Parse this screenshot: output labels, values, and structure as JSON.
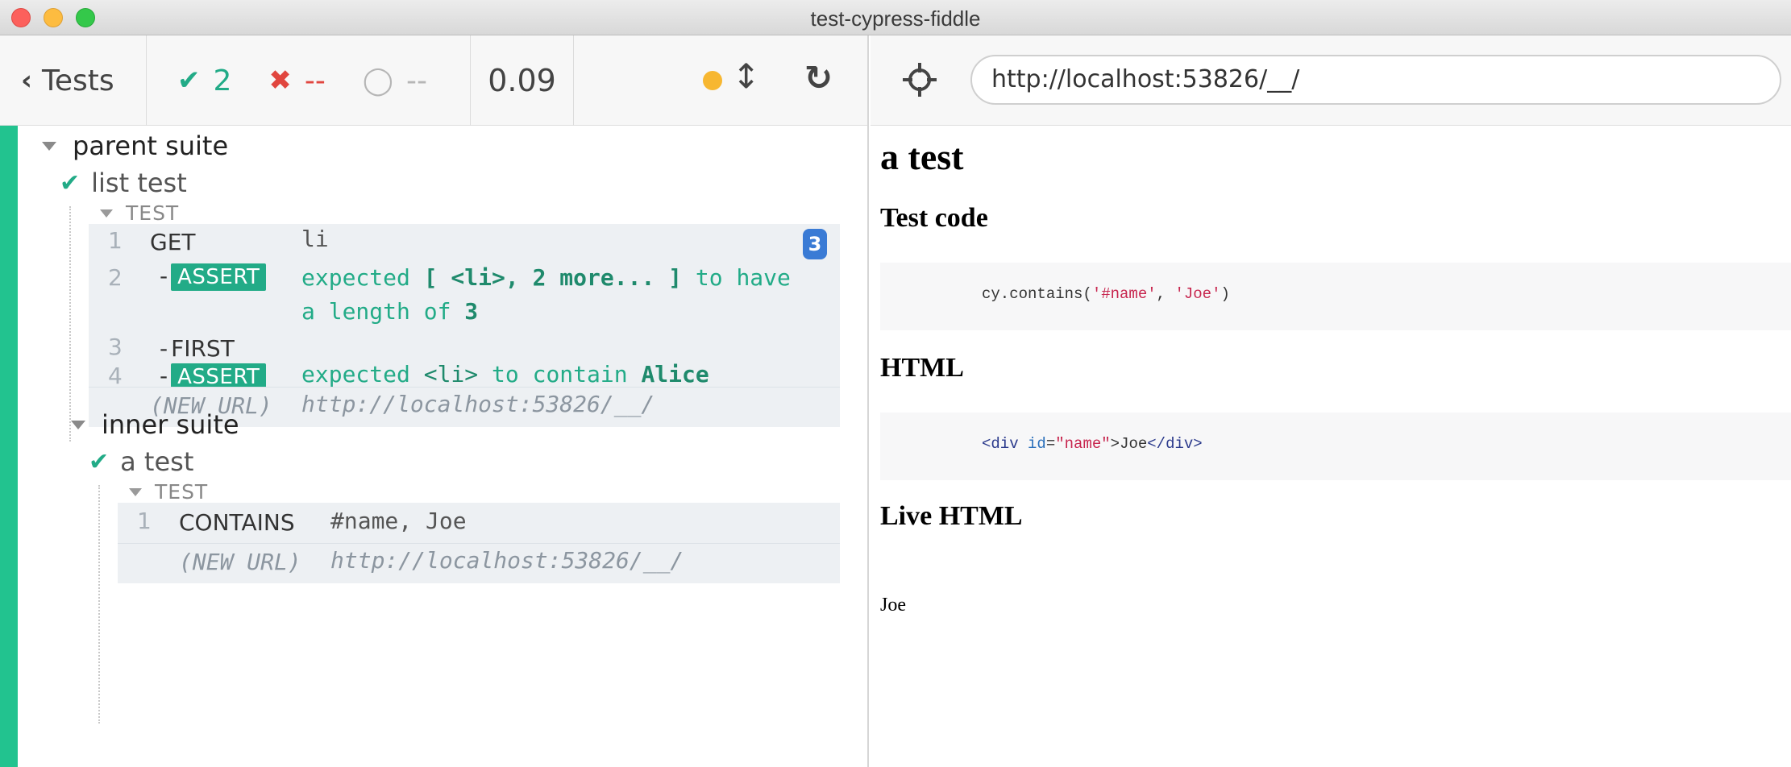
{
  "window": {
    "title": "test-cypress-fiddle"
  },
  "reporter": {
    "header": {
      "tests_label": "Tests",
      "passed": "2",
      "failed": "--",
      "pending": "--",
      "duration": "0.09"
    },
    "parent_suite": "parent suite",
    "test1": {
      "title": "list test",
      "section": "TEST",
      "commands": [
        {
          "num": "1",
          "name": "GET",
          "message": "li",
          "badge": "3"
        },
        {
          "num": "2",
          "name": "ASSERT",
          "msg_a": "expected",
          "msg_b": "[ <li>, 2 more... ]",
          "msg_c": "to have",
          "msg_d": "a length of",
          "msg_e": "3"
        },
        {
          "num": "3",
          "name": "FIRST"
        },
        {
          "num": "4",
          "name": "ASSERT",
          "msg_a": "expected",
          "msg_b": "<li>",
          "msg_c": "to contain",
          "msg_d": "Alice"
        }
      ],
      "new_url_label": "(NEW URL)",
      "new_url": "http://localhost:53826/__/"
    },
    "inner_suite": "inner suite",
    "test2": {
      "title": "a test",
      "section": "TEST",
      "commands": [
        {
          "num": "1",
          "name": "CONTAINS",
          "message": "#name, Joe"
        }
      ],
      "new_url_label": "(NEW URL)",
      "new_url": "http://localhost:53826/__/"
    },
    "dash": "-"
  },
  "app": {
    "url": "http://localhost:53826/__/",
    "heading": "a test",
    "test_code_heading": "Test code",
    "code": {
      "fn": "cy.contains(",
      "arg1": "'#name'",
      "sep": ", ",
      "arg2": "'Joe'",
      "close": ")"
    },
    "html_heading": "HTML",
    "html_code": {
      "open": "<div",
      "attr": "id",
      "eq": "=",
      "val": "\"name\"",
      "gt": ">",
      "text": "Joe",
      "close": "</div>"
    },
    "live_heading": "Live HTML",
    "live_text": "Joe"
  },
  "colors": {
    "pass": "#22ab87",
    "fail": "#e1463f",
    "accent_bar": "#22c38f",
    "badge": "#3a7bd5"
  }
}
